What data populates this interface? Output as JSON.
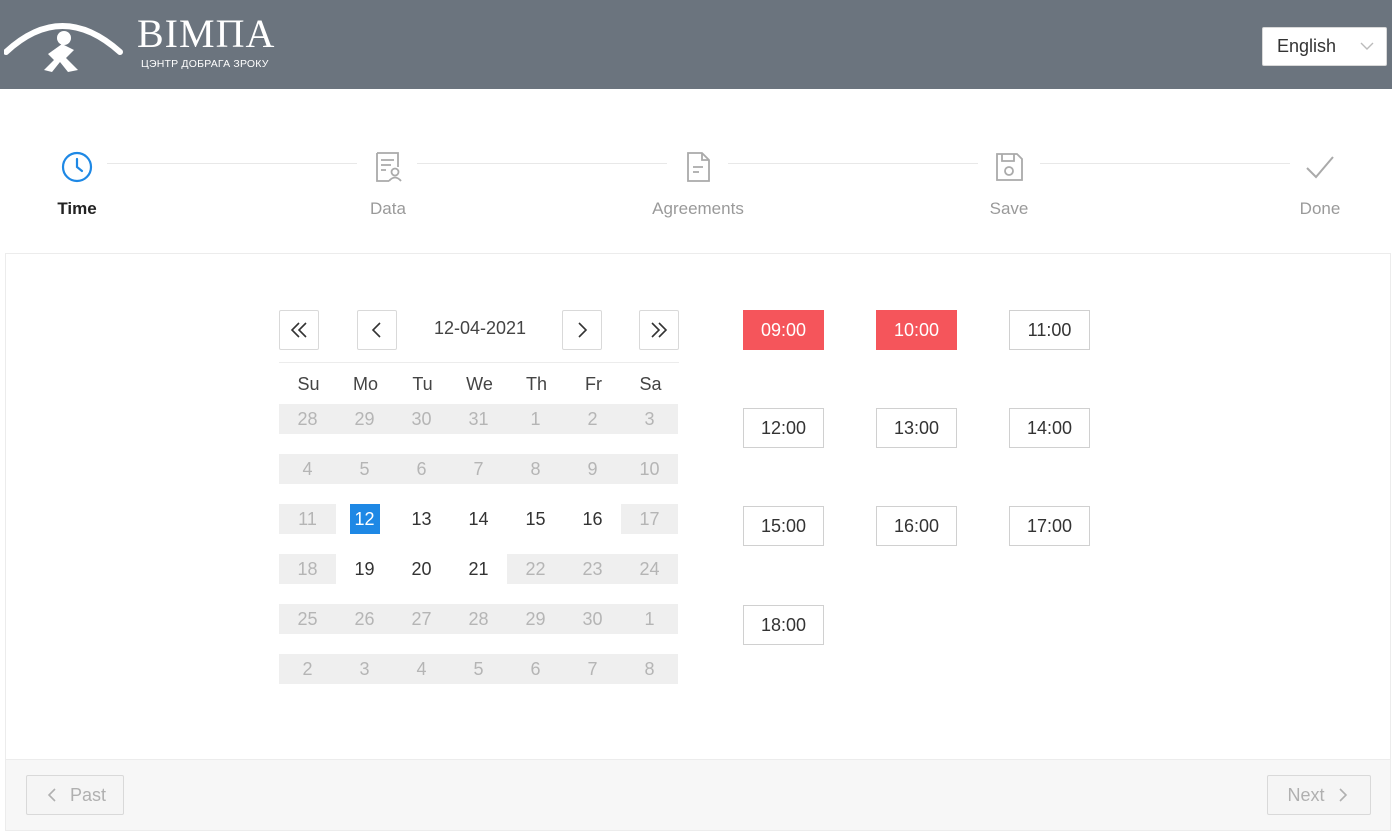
{
  "header": {
    "logo_title": "ВІМПА",
    "logo_subtitle": "ЦЭНТР ДОБРАГА ЗРОКУ",
    "language": "English",
    "bg_color": "#6b747e"
  },
  "steps": [
    {
      "label": "Time",
      "icon": "clock-icon",
      "active": true
    },
    {
      "label": "Data",
      "icon": "document-user-icon",
      "active": false
    },
    {
      "label": "Agreements",
      "icon": "file-text-icon",
      "active": false
    },
    {
      "label": "Save",
      "icon": "floppy-disk-icon",
      "active": false
    },
    {
      "label": "Done",
      "icon": "checkmark-icon",
      "active": false
    }
  ],
  "calendar": {
    "date": "12-04-2021",
    "weekdays": [
      "Su",
      "Mo",
      "Tu",
      "We",
      "Th",
      "Fr",
      "Sa"
    ],
    "weeks": [
      [
        "28",
        "29",
        "30",
        "31",
        "1",
        "2",
        "3"
      ],
      [
        "4",
        "5",
        "6",
        "7",
        "8",
        "9",
        "10"
      ],
      [
        "11",
        "12",
        "13",
        "14",
        "15",
        "16",
        "17"
      ],
      [
        "18",
        "19",
        "20",
        "21",
        "22",
        "23",
        "24"
      ],
      [
        "25",
        "26",
        "27",
        "28",
        "29",
        "30",
        "1"
      ],
      [
        "2",
        "3",
        "4",
        "5",
        "6",
        "7",
        "8"
      ]
    ],
    "available_days": [
      "12",
      "13",
      "14",
      "15",
      "16",
      "19",
      "20",
      "21"
    ],
    "selected_day": "12",
    "selected_color": "#1e88e5"
  },
  "slots": [
    {
      "time": "09:00",
      "busy": true
    },
    {
      "time": "10:00",
      "busy": true
    },
    {
      "time": "11:00",
      "busy": false
    },
    {
      "time": "12:00",
      "busy": false
    },
    {
      "time": "13:00",
      "busy": false
    },
    {
      "time": "14:00",
      "busy": false
    },
    {
      "time": "15:00",
      "busy": false
    },
    {
      "time": "16:00",
      "busy": false
    },
    {
      "time": "17:00",
      "busy": false
    },
    {
      "time": "18:00",
      "busy": false
    }
  ],
  "busy_color": "#f5555b",
  "footer": {
    "past_label": "Past",
    "next_label": "Next"
  }
}
